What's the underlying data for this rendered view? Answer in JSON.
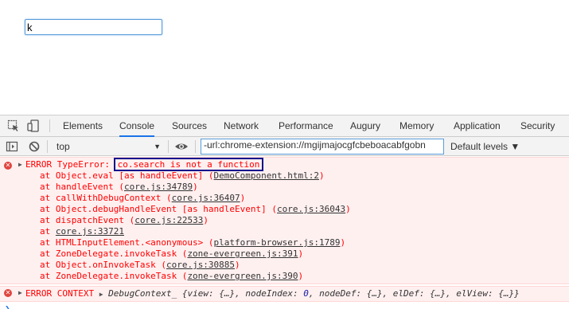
{
  "page": {
    "input_value": "k"
  },
  "devtools": {
    "tabs": [
      {
        "label": "Elements"
      },
      {
        "label": "Console"
      },
      {
        "label": "Sources"
      },
      {
        "label": "Network"
      },
      {
        "label": "Performance"
      },
      {
        "label": "Augury"
      },
      {
        "label": "Memory"
      },
      {
        "label": "Application"
      },
      {
        "label": "Security"
      }
    ],
    "active_tab": "Console",
    "console_bar": {
      "context": "top",
      "filter_value": "-url:chrome-extension://mgijmajocgfcbeboacabfgobn",
      "levels_label": "Default levels ▼"
    },
    "messages": {
      "error1": {
        "prefix": "ERROR TypeError: ",
        "highlight": "co.search is not a function",
        "stack": [
          {
            "text": "at Object.eval [as handleEvent] (",
            "link": "DemoComponent.html:2",
            "tail": ")"
          },
          {
            "text": "at handleEvent (",
            "link": "core.js:34789",
            "tail": ")"
          },
          {
            "text": "at callWithDebugContext (",
            "link": "core.js:36407",
            "tail": ")"
          },
          {
            "text": "at Object.debugHandleEvent [as handleEvent] (",
            "link": "core.js:36043",
            "tail": ")"
          },
          {
            "text": "at dispatchEvent (",
            "link": "core.js:22533",
            "tail": ")"
          },
          {
            "text": "at ",
            "link": "core.js:33721",
            "tail": ""
          },
          {
            "text": "at HTMLInputElement.<anonymous> (",
            "link": "platform-browser.js:1789",
            "tail": ")"
          },
          {
            "text": "at ZoneDelegate.invokeTask (",
            "link": "zone-evergreen.js:391",
            "tail": ")"
          },
          {
            "text": "at Object.onInvokeTask (",
            "link": "core.js:30885",
            "tail": ")"
          },
          {
            "text": "at ZoneDelegate.invokeTask (",
            "link": "zone-evergreen.js:390",
            "tail": ")"
          }
        ]
      },
      "error2": {
        "label": "ERROR CONTEXT",
        "object_name": "DebugContext_",
        "props_pre": "{view: {…}, nodeIndex: ",
        "node_index": "0",
        "props_post": ", nodeDef: {…}, elDef: {…}, elView: {…}}"
      }
    },
    "colors": {
      "error_text": "#ff0000",
      "error_bg": "#fff0f0",
      "accent": "#1a73e8"
    }
  }
}
